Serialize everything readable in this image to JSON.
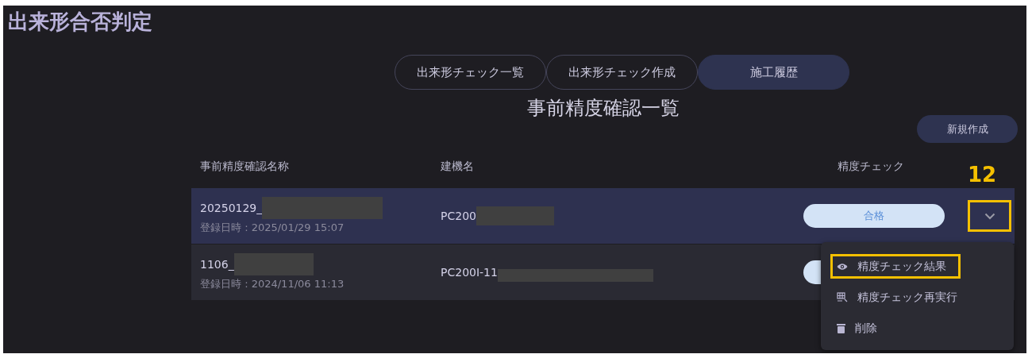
{
  "page": {
    "title": "出来形合否判定"
  },
  "tabs": [
    {
      "label": "出来形チェック一覧",
      "selected": false
    },
    {
      "label": "出来形チェック作成",
      "selected": false
    },
    {
      "label": "施工履歴",
      "selected": true
    }
  ],
  "section_title": "事前精度確認一覧",
  "new_button": "新規作成",
  "table": {
    "columns": [
      "事前精度確認名称",
      "建機名",
      "精度チェック"
    ],
    "rows": [
      {
        "name": "20250129_",
        "name_redacted": true,
        "registered": "登録日時 : 2025/01/29 15:07",
        "machine": "PC200",
        "machine_redacted": true,
        "check": "合格",
        "selected": true
      },
      {
        "name": "1106_",
        "name_redacted": true,
        "registered": "登録日時 : 2024/11/06 11:13",
        "machine": "PC200I-11",
        "machine_redacted": true,
        "selected": false
      }
    ]
  },
  "annotation": {
    "label": "12"
  },
  "menu": {
    "items": [
      {
        "kind": "eye",
        "label": "精度チェック結果",
        "highlighted": true
      },
      {
        "kind": "grid",
        "label": "精度チェック再実行",
        "highlighted": false
      },
      {
        "kind": "trash",
        "label": "削除",
        "highlighted": false
      }
    ]
  }
}
